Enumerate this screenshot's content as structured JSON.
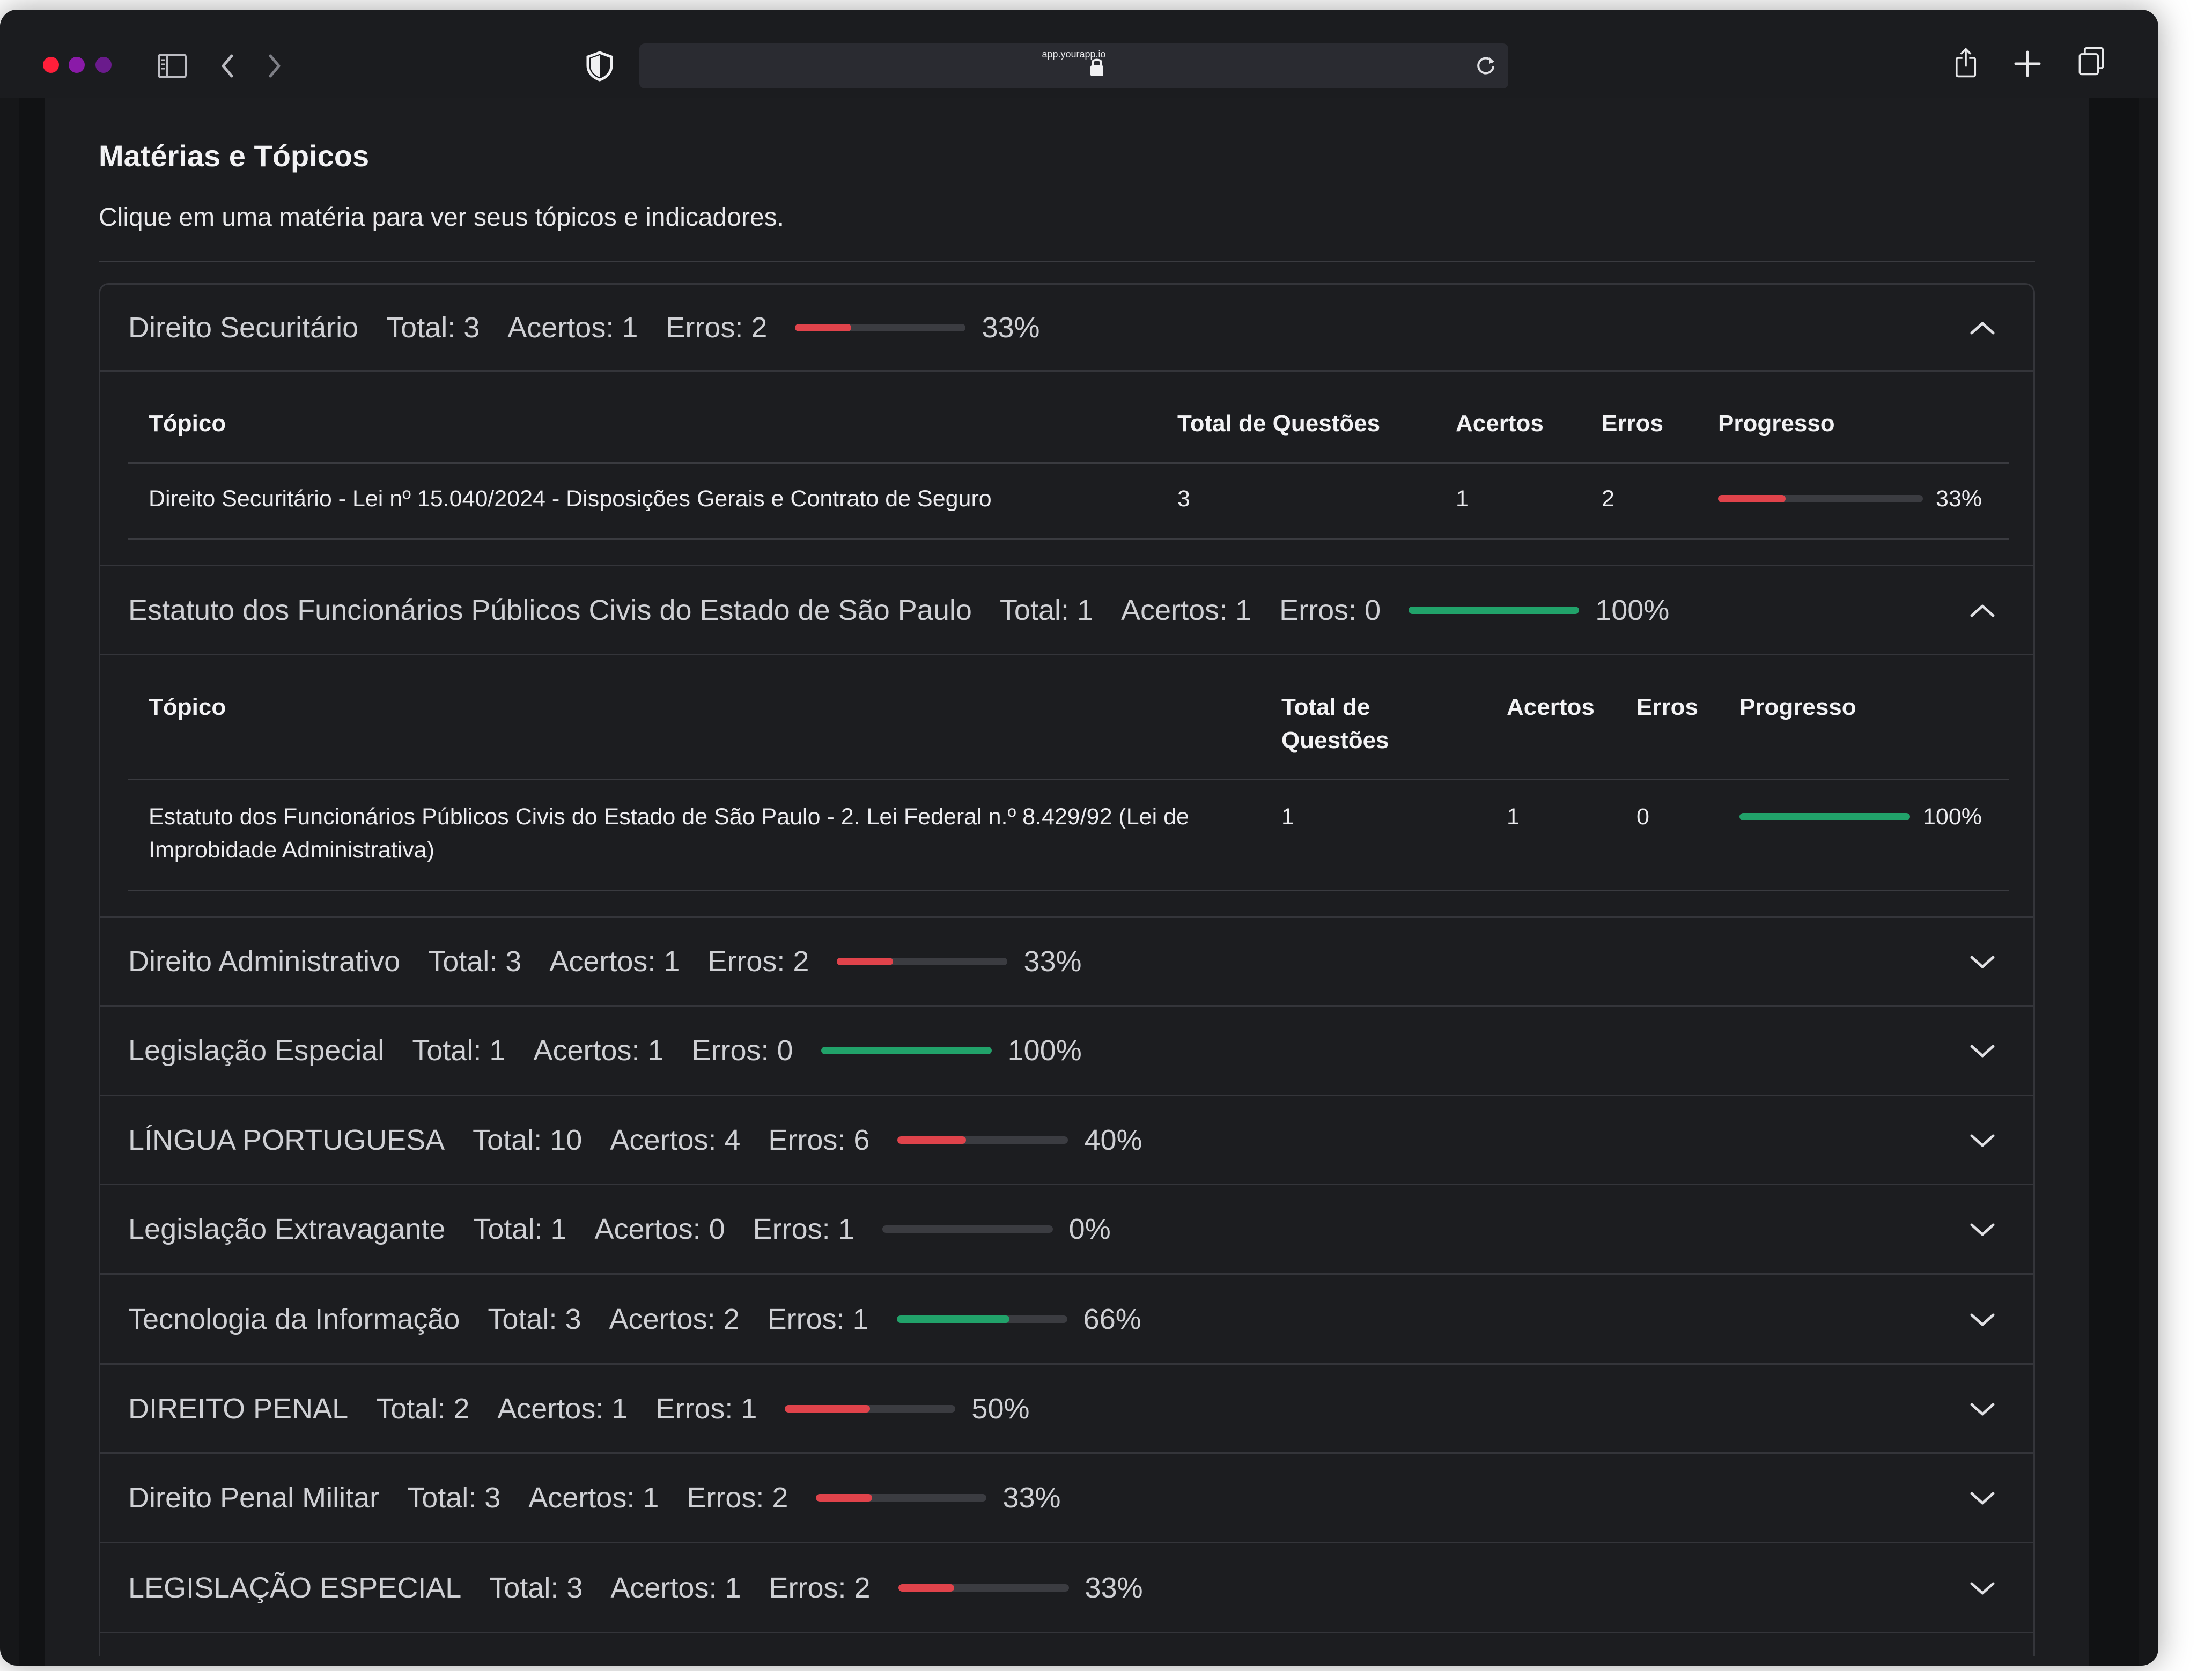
{
  "browser": {
    "url": "app.yourapp.io",
    "icons": [
      "sidebar-icon",
      "back-icon",
      "forward-icon",
      "shield-icon",
      "lock-icon",
      "reload-icon",
      "share-icon",
      "new-tab-icon",
      "tabs-icon"
    ]
  },
  "page": {
    "title": "Matérias e Tópicos",
    "subtitle": "Clique em uma matéria para ver seus tópicos e indicadores."
  },
  "table_headers": {
    "topic": "Tópico",
    "total": "Total de Questões",
    "total_line1": "Total de",
    "total_line2": "Questões",
    "hits": "Acertos",
    "errors": "Erros",
    "progress": "Progresso"
  },
  "colors": {
    "bad": "#e0434b",
    "good": "#21a26a",
    "track": "#3b3c41"
  },
  "subjects": [
    {
      "name": "Direito Securitário",
      "total": "Total: 3",
      "hits": "Acertos: 1",
      "errors": "Erros: 2",
      "pct": "33%",
      "progress": 0.33,
      "color": "red",
      "expanded": true,
      "topics": [
        {
          "topic": "Direito Securitário - Lei nº 15.040/2024 - Disposições Gerais e Contrato de Seguro",
          "total": "3",
          "hits": "1",
          "errors": "2",
          "pct": "33%",
          "progress": 0.33,
          "color": "red"
        }
      ]
    },
    {
      "name": "Estatuto dos Funcionários Públicos Civis do Estado de São Paulo",
      "total": "Total: 1",
      "hits": "Acertos: 1",
      "errors": "Erros: 0",
      "pct": "100%",
      "progress": 1.0,
      "color": "green",
      "expanded": true,
      "topics": [
        {
          "topic_line1": "Estatuto dos Funcionários Públicos Civis do Estado de São Paulo - 2. Lei Federal n.º 8.429/92 (Lei de",
          "topic_line2": "Improbidade Administrativa)",
          "total": "1",
          "hits": "1",
          "errors": "0",
          "pct": "100%",
          "progress": 1.0,
          "color": "green"
        }
      ]
    },
    {
      "name": "Direito Administrativo",
      "total": "Total: 3",
      "hits": "Acertos: 1",
      "errors": "Erros: 2",
      "pct": "33%",
      "progress": 0.33,
      "color": "red",
      "expanded": false
    },
    {
      "name": "Legislação Especial",
      "total": "Total: 1",
      "hits": "Acertos: 1",
      "errors": "Erros: 0",
      "pct": "100%",
      "progress": 1.0,
      "color": "green",
      "expanded": false
    },
    {
      "name": "LÍNGUA PORTUGUESA",
      "total": "Total: 10",
      "hits": "Acertos: 4",
      "errors": "Erros: 6",
      "pct": "40%",
      "progress": 0.4,
      "color": "red",
      "expanded": false
    },
    {
      "name": "Legislação Extravagante",
      "total": "Total: 1",
      "hits": "Acertos: 0",
      "errors": "Erros: 1",
      "pct": "0%",
      "progress": 0.0,
      "color": "red",
      "expanded": false
    },
    {
      "name": "Tecnologia da Informação",
      "total": "Total: 3",
      "hits": "Acertos: 2",
      "errors": "Erros: 1",
      "pct": "66%",
      "progress": 0.66,
      "color": "green",
      "expanded": false
    },
    {
      "name": "DIREITO PENAL",
      "total": "Total: 2",
      "hits": "Acertos: 1",
      "errors": "Erros: 1",
      "pct": "50%",
      "progress": 0.5,
      "color": "red",
      "expanded": false
    },
    {
      "name": "Direito Penal Militar",
      "total": "Total: 3",
      "hits": "Acertos: 1",
      "errors": "Erros: 2",
      "pct": "33%",
      "progress": 0.33,
      "color": "red",
      "expanded": false
    },
    {
      "name": "LEGISLAÇÃO ESPECIAL",
      "total": "Total: 3",
      "hits": "Acertos: 1",
      "errors": "Erros: 2",
      "pct": "33%",
      "progress": 0.33,
      "color": "red",
      "expanded": false
    }
  ]
}
